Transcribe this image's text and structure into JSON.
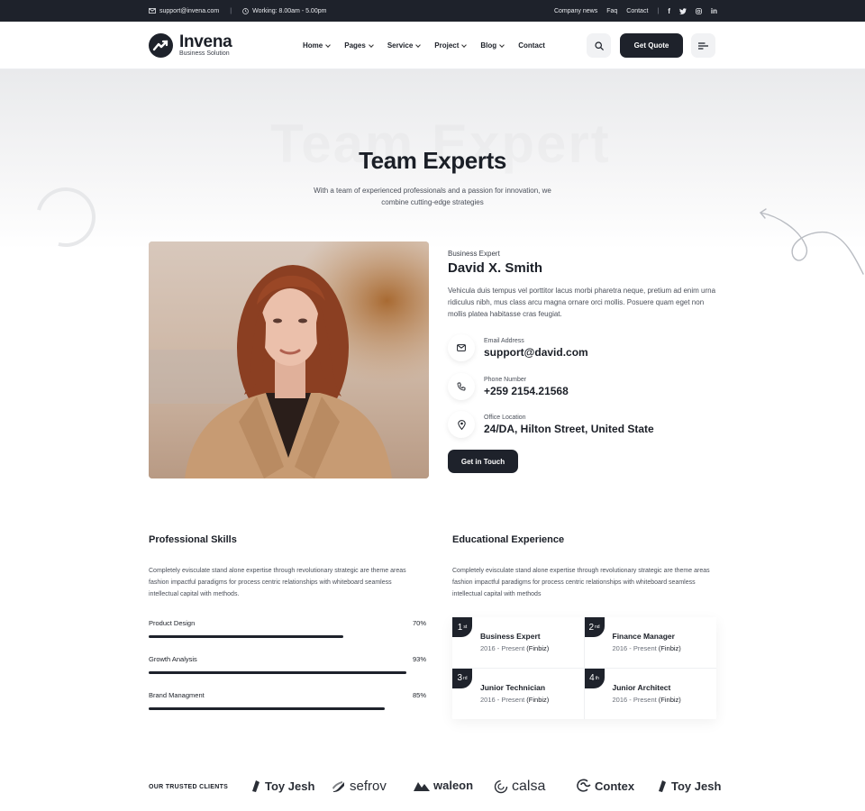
{
  "topbar": {
    "email": "support@invena.com",
    "hours": "Working: 8.00am - 5.00pm",
    "links": [
      "Company news",
      "Faq",
      "Contact"
    ]
  },
  "header": {
    "logo_name": "Invena",
    "logo_tag": "Business Solution",
    "nav": [
      {
        "label": "Home"
      },
      {
        "label": "Pages"
      },
      {
        "label": "Service"
      },
      {
        "label": "Project"
      },
      {
        "label": "Blog"
      },
      {
        "label": "Contact"
      }
    ],
    "quote_label": "Get Quote"
  },
  "hero": {
    "ghost": "Team Expert",
    "title": "Team Experts",
    "desc": "With a team of experienced professionals and a passion for innovation, we combine cutting-edge strategies"
  },
  "profile": {
    "role": "Business Expert",
    "name": "David X. Smith",
    "desc": "Vehicula duis tempus vel porttitor lacus morbi pharetra neque, pretium ad enim urna ridiculus nibh, mus class arcu magna ornare orci mollis. Posuere quam eget non mollis platea habitasse cras feugiat.",
    "contacts": [
      {
        "label": "Email Address",
        "value": "support@david.com"
      },
      {
        "label": "Phone Number",
        "value": "+259 2154.21568"
      },
      {
        "label": "Office Location",
        "value": "24/DA, Hilton Street, United State"
      }
    ],
    "touch_label": "Get in Touch"
  },
  "skills": {
    "title": "Professional Skills",
    "desc": "Completely evisculate stand alone expertise through revolutionary strategic are theme areas fashion impactful paradigms for process centric relationships with whiteboard seamless intellectual capital with methods.",
    "items": [
      {
        "label": "Product Design",
        "percent_text": "70%",
        "value": 0.7
      },
      {
        "label": "Growth Analysis",
        "percent_text": "93%",
        "value": 0.93
      },
      {
        "label": "Brand Managment",
        "percent_text": "85%",
        "value": 0.85
      }
    ]
  },
  "education": {
    "title": "Educational Experience",
    "desc": "Completely evisculate stand alone expertise through revolutionary strategic are theme areas fashion impactful paradigms for process centric relationships with whiteboard seamless intellectual capital with methods",
    "items": [
      {
        "num": "1",
        "ord": "st",
        "title": "Business Expert",
        "period": "2016 - Present",
        "org": "(Finbiz)"
      },
      {
        "num": "2",
        "ord": "nd",
        "title": "Finance Manager",
        "period": "2016 - Present",
        "org": "(Finbiz)"
      },
      {
        "num": "3",
        "ord": "rd",
        "title": "Junior Technician",
        "period": "2016 - Present",
        "org": "(Finbiz)"
      },
      {
        "num": "4",
        "ord": "th",
        "title": "Junior Architect",
        "period": "2016 - Present",
        "org": "(Finbiz)"
      }
    ]
  },
  "clients": {
    "label": "OUR TRUSTED CLIENTS",
    "names": [
      "Toy Jesh",
      "sefrov",
      "waleon",
      "calsa",
      "Contex",
      "Toy Jesh"
    ]
  },
  "colors": {
    "dark": "#1e222b",
    "text": "#1b1f27",
    "muted": "#4a4f59"
  }
}
